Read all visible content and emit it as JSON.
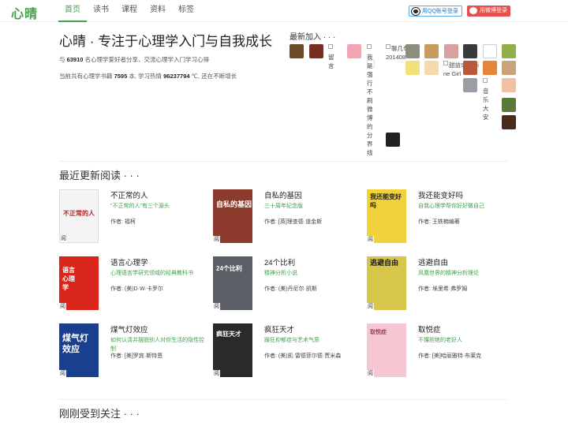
{
  "header": {
    "logo": "心晴",
    "nav": [
      "首页",
      "读书",
      "课程",
      "资料",
      "标签"
    ],
    "qq_login": "用QQ账号登录",
    "weibo_login": "用微博登录"
  },
  "intro": {
    "title": "心晴 · 专注于心理学入门与自我成长",
    "line1_pre": "与",
    "line1_count": "63910",
    "line1_post": "名心理学爱好者分享、交流心理学入门学习心得",
    "line2_pre": "当前共有心理学书籍",
    "line2_books": "7595",
    "line2_mid": "本, 学习热情",
    "line2_heat": "96237794",
    "line2_post": "℃, 还在不断增长"
  },
  "new_members": {
    "title": "最新加入 · · ·",
    "broken_labels": [
      "留言",
      "我是强行不刷微博的分界线",
      "聊几句",
      "201408",
      "甜益Sunshine Girl",
      "音乐大安"
    ]
  },
  "recent": {
    "title": "最近更新阅读 · · ·",
    "read_tag": "阅",
    "books": [
      {
        "title": "不正常的人",
        "subtitle": "\"不正常的人\"有三个源头",
        "author": "作者: 福柯",
        "cover_text": "不正常的人",
        "cover_color": "#f4f4f4"
      },
      {
        "title": "自私的基因",
        "subtitle": "三十周年纪念版",
        "author": "作者: [英]理查德·道金斯",
        "cover_text": "自私的基因",
        "cover_color": "#8b3a2b"
      },
      {
        "title": "我还能变好吗",
        "subtitle": "自我心理学帮你好好做自己",
        "author": "作者: 王轶楠编著",
        "cover_text": "我还能变好吗",
        "cover_color": "#f1d23a"
      },
      {
        "title": "语言心理学",
        "subtitle": "心理语言学研究领域的经典教科书",
        "author": "作者: (美)D·W·卡罗尔",
        "cover_text": "语言心理学",
        "cover_color": "#d9261c"
      },
      {
        "title": "24个比利",
        "subtitle": "精神分析小说",
        "author": "作者: (美)丹尼尔·凯斯",
        "cover_text": "24个比利",
        "cover_color": "#5a5f66"
      },
      {
        "title": "逃避自由",
        "subtitle": "凤凰世界的精神分析理论",
        "author": "作者: 埃里希·弗罗姆",
        "cover_text": "逃避自由",
        "cover_color": "#d6c74a"
      },
      {
        "title": "煤气灯效应",
        "subtitle": "如何认清并摆脱别人对你生活的隐性控制",
        "author": "作者: [美]罗宾·斯特恩",
        "cover_text": "煤气灯效应",
        "cover_color": "#1a3f8f"
      },
      {
        "title": "疯狂天才",
        "subtitle": "躁狂抑郁症与艺术气质",
        "author": "作者: (美)凯·雷德菲尔德·贾米森",
        "cover_text": "疯狂天才",
        "cover_color": "#2a2a2a"
      },
      {
        "title": "取悦症",
        "subtitle": "不懂拒绝的老好人",
        "author": "作者: [美]哈丽雅特·布莱克",
        "cover_text": "取悦症",
        "cover_color": "#f6c6d3"
      }
    ]
  },
  "followed": {
    "title": "刚刚受到关注 · · ·"
  }
}
